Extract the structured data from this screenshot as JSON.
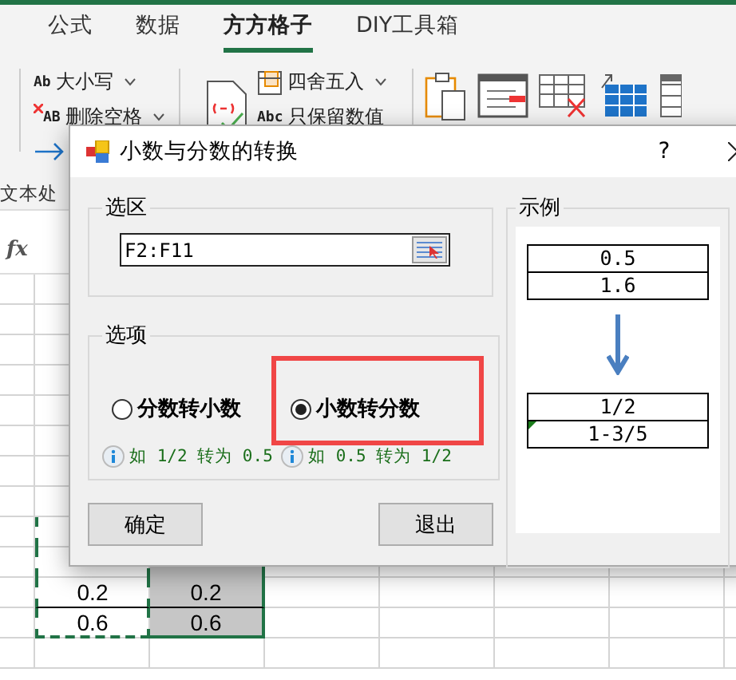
{
  "ribbon_tabs": [
    {
      "label": "公式",
      "selected": false
    },
    {
      "label": "数据",
      "selected": false
    },
    {
      "label": "方方格子",
      "selected": true
    },
    {
      "label": "DIY工具箱",
      "selected": false
    }
  ],
  "ribbon_commands": [
    {
      "icon_text": "Ab",
      "label": "大小写",
      "dropdown": true
    },
    {
      "icon_text": "AB",
      "label": "删除空格",
      "dropdown": true
    },
    {
      "label": "四舍五入",
      "dropdown": true
    },
    {
      "icon_text": "Abc",
      "label": "只保留数值",
      "dropdown": false
    }
  ],
  "ribbon_group_label": "文本处",
  "formula_bar": {
    "function_label": "fx"
  },
  "sheet_rows": [
    {
      "column_b": "0.2",
      "column_c": "0.2"
    },
    {
      "column_b": "0.6",
      "column_c": "0.6"
    }
  ],
  "dialog": {
    "title": "小数与分数的转换",
    "help": "?",
    "range_group": {
      "legend": "选区",
      "range": "F2:F11"
    },
    "options_group": {
      "legend": "选项",
      "options": [
        {
          "label": "分数转小数",
          "selected": false,
          "highlighted": false,
          "hint": "如 1/2 转为 0.5"
        },
        {
          "label": "小数转分数",
          "selected": true,
          "highlighted": true,
          "hint": "如 0.5 转为 1/2"
        }
      ]
    },
    "buttons": [
      "确定",
      "退出"
    ],
    "example_group": {
      "legend": "示例",
      "before": [
        {
          "text": "0.5",
          "flagged": false
        },
        {
          "text": "1.6",
          "flagged": false
        }
      ],
      "after": [
        {
          "text": "1/2",
          "flagged": false
        },
        {
          "text": "1-3/5",
          "flagged": true
        }
      ]
    }
  }
}
